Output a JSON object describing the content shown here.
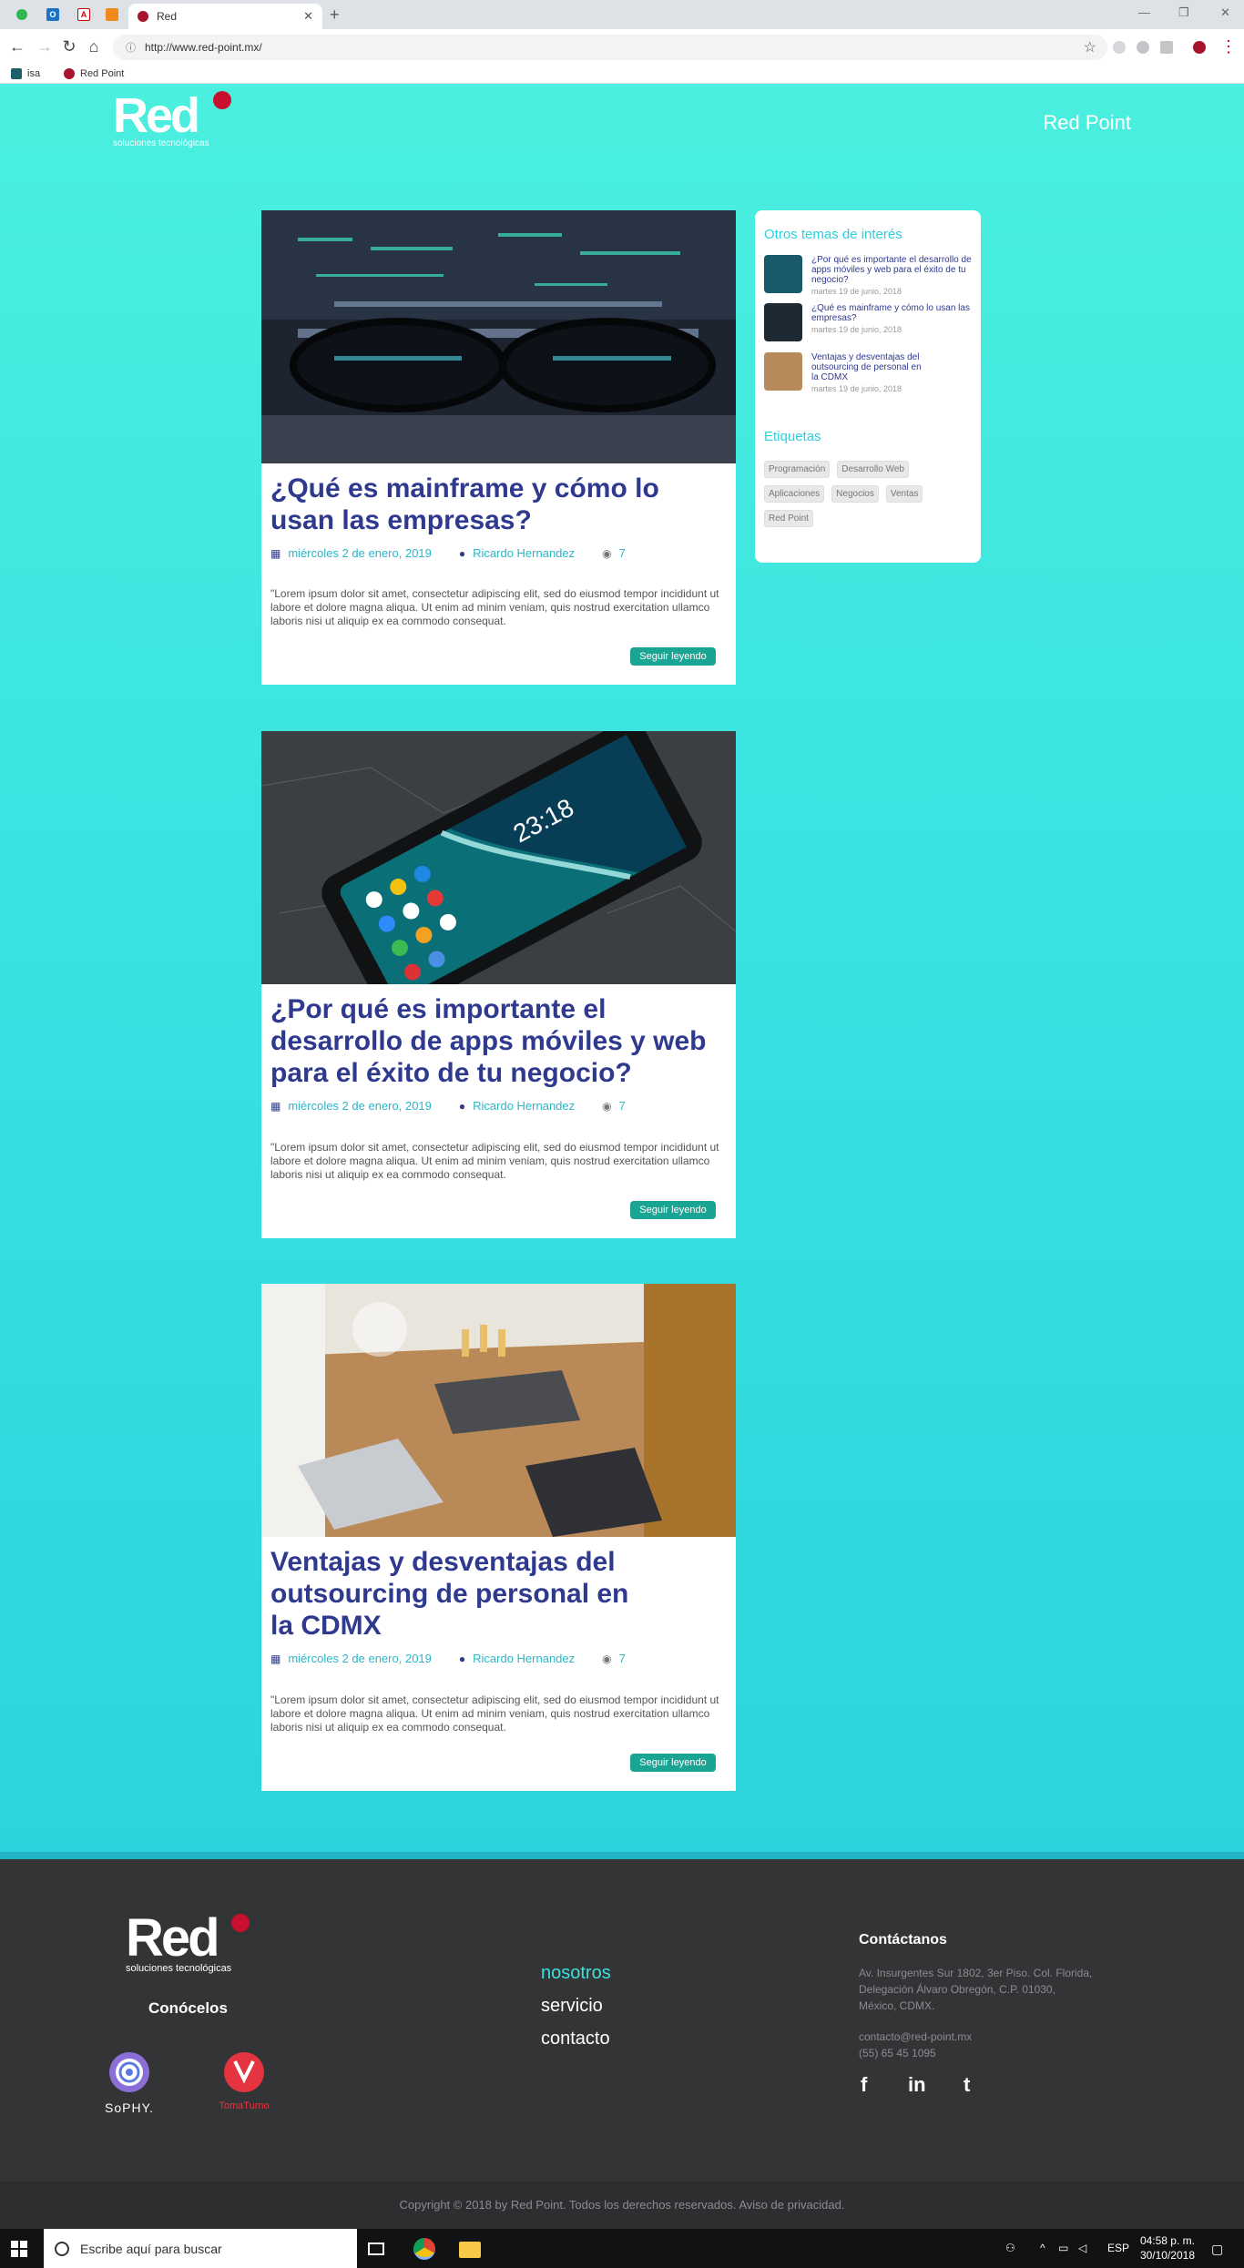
{
  "browser": {
    "tab_title": "Red",
    "url": "http://www.red-point.mx/",
    "bookmarks": [
      "isa",
      "Red Point"
    ]
  },
  "header": {
    "logo_word": "Red",
    "logo_tagline": "soluciones tecnológicas",
    "brand": "Red Point"
  },
  "posts": [
    {
      "title": "¿Qué es mainframe y cómo lo usan las empresas?",
      "date": "miércoles 2 de enero, 2019",
      "author": "Ricardo Hernandez",
      "views": "7",
      "excerpt": "\"Lorem ipsum dolor sit amet, consectetur adipiscing elit, sed do eiusmod tempor incididunt ut labore et dolore magna aliqua. Ut enim ad minim veniam, quis nostrud exercitation ullamco laboris nisi ut aliquip ex ea commodo consequat.",
      "button": "Seguir leyendo"
    },
    {
      "title": "¿Por qué es importante el desarrollo de apps móviles y web para el éxito de tu negocio?",
      "date": "miércoles 2 de enero, 2019",
      "author": "Ricardo Hernandez",
      "views": "7",
      "excerpt": "\"Lorem ipsum dolor sit amet, consectetur adipiscing elit, sed do eiusmod tempor incididunt ut labore et dolore magna aliqua. Ut enim ad minim veniam, quis nostrud exercitation ullamco laboris nisi ut aliquip ex ea commodo consequat.",
      "button": "Seguir leyendo"
    },
    {
      "title": "Ventajas y desventajas del outsourcing de personal en la CDMX",
      "date": "miércoles 2 de enero, 2019",
      "author": "Ricardo Hernandez",
      "views": "7",
      "excerpt": "\"Lorem ipsum dolor sit amet, consectetur adipiscing elit, sed do eiusmod tempor incididunt ut labore et dolore magna aliqua. Ut enim ad minim veniam, quis nostrud exercitation ullamco laboris nisi ut aliquip ex ea commodo consequat.",
      "button": "Seguir leyendo"
    }
  ],
  "sidebar": {
    "related_heading": "Otros temas de interés",
    "related": [
      {
        "title": "¿Por qué es importante el desarrollo de apps móviles y web para el éxito de tu negocio?",
        "date": "martes 19 de junio, 2018"
      },
      {
        "title": "¿Qué es mainframe y cómo lo usan las empresas?",
        "date": "martes 19 de junio, 2018"
      },
      {
        "title": "Ventajas y desventajas del outsourcing de personal en la CDMX",
        "date": "martes 19 de junio, 2018"
      }
    ],
    "tags_heading": "Etiquetas",
    "tags": [
      "Programación",
      "Desarrollo Web",
      "Aplicaciones",
      "Negocios",
      "Ventas",
      "Red Point"
    ]
  },
  "footer": {
    "conocelos": "Conócelos",
    "partners": [
      "SoPHY.",
      "TomaTurno"
    ],
    "nav": [
      "nosotros",
      "servicio",
      "contacto"
    ],
    "contact_heading": "Contáctanos",
    "address": "Av. Insurgentes Sur 1802, 3er Piso. Col. Florida, Delegación Álvaro Obregón, C.P. 01030, México, CDMX.",
    "email": "contacto@red-point.mx",
    "phone": "(55) 65 45 1095",
    "social": [
      "f",
      "in",
      "t"
    ],
    "copyright": "Copyright © 2018 by Red Point. Todos los derechos reservados. Aviso de privacidad."
  },
  "taskbar": {
    "search_placeholder": "Escribe aquí para buscar",
    "lang": "ESP",
    "time": "04:58 p. m.",
    "date": "30/10/2018"
  },
  "colors": {
    "brand_red": "#c8102e",
    "title_navy": "#2f3a8f",
    "accent_teal": "#1aa494",
    "bg_cyan": "#3ee6e0"
  }
}
